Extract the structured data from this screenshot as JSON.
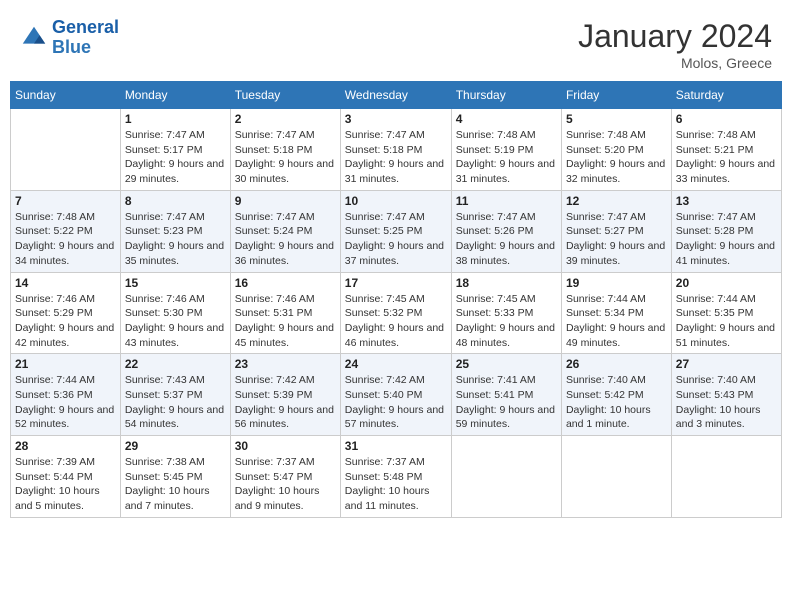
{
  "header": {
    "logo_line1": "General",
    "logo_line2": "Blue",
    "month_year": "January 2024",
    "location": "Molos, Greece"
  },
  "days_of_week": [
    "Sunday",
    "Monday",
    "Tuesday",
    "Wednesday",
    "Thursday",
    "Friday",
    "Saturday"
  ],
  "weeks": [
    [
      {
        "day": "",
        "sunrise": "",
        "sunset": "",
        "daylight": ""
      },
      {
        "day": "1",
        "sunrise": "Sunrise: 7:47 AM",
        "sunset": "Sunset: 5:17 PM",
        "daylight": "Daylight: 9 hours and 29 minutes."
      },
      {
        "day": "2",
        "sunrise": "Sunrise: 7:47 AM",
        "sunset": "Sunset: 5:18 PM",
        "daylight": "Daylight: 9 hours and 30 minutes."
      },
      {
        "day": "3",
        "sunrise": "Sunrise: 7:47 AM",
        "sunset": "Sunset: 5:18 PM",
        "daylight": "Daylight: 9 hours and 31 minutes."
      },
      {
        "day": "4",
        "sunrise": "Sunrise: 7:48 AM",
        "sunset": "Sunset: 5:19 PM",
        "daylight": "Daylight: 9 hours and 31 minutes."
      },
      {
        "day": "5",
        "sunrise": "Sunrise: 7:48 AM",
        "sunset": "Sunset: 5:20 PM",
        "daylight": "Daylight: 9 hours and 32 minutes."
      },
      {
        "day": "6",
        "sunrise": "Sunrise: 7:48 AM",
        "sunset": "Sunset: 5:21 PM",
        "daylight": "Daylight: 9 hours and 33 minutes."
      }
    ],
    [
      {
        "day": "7",
        "sunrise": "Sunrise: 7:48 AM",
        "sunset": "Sunset: 5:22 PM",
        "daylight": "Daylight: 9 hours and 34 minutes."
      },
      {
        "day": "8",
        "sunrise": "Sunrise: 7:47 AM",
        "sunset": "Sunset: 5:23 PM",
        "daylight": "Daylight: 9 hours and 35 minutes."
      },
      {
        "day": "9",
        "sunrise": "Sunrise: 7:47 AM",
        "sunset": "Sunset: 5:24 PM",
        "daylight": "Daylight: 9 hours and 36 minutes."
      },
      {
        "day": "10",
        "sunrise": "Sunrise: 7:47 AM",
        "sunset": "Sunset: 5:25 PM",
        "daylight": "Daylight: 9 hours and 37 minutes."
      },
      {
        "day": "11",
        "sunrise": "Sunrise: 7:47 AM",
        "sunset": "Sunset: 5:26 PM",
        "daylight": "Daylight: 9 hours and 38 minutes."
      },
      {
        "day": "12",
        "sunrise": "Sunrise: 7:47 AM",
        "sunset": "Sunset: 5:27 PM",
        "daylight": "Daylight: 9 hours and 39 minutes."
      },
      {
        "day": "13",
        "sunrise": "Sunrise: 7:47 AM",
        "sunset": "Sunset: 5:28 PM",
        "daylight": "Daylight: 9 hours and 41 minutes."
      }
    ],
    [
      {
        "day": "14",
        "sunrise": "Sunrise: 7:46 AM",
        "sunset": "Sunset: 5:29 PM",
        "daylight": "Daylight: 9 hours and 42 minutes."
      },
      {
        "day": "15",
        "sunrise": "Sunrise: 7:46 AM",
        "sunset": "Sunset: 5:30 PM",
        "daylight": "Daylight: 9 hours and 43 minutes."
      },
      {
        "day": "16",
        "sunrise": "Sunrise: 7:46 AM",
        "sunset": "Sunset: 5:31 PM",
        "daylight": "Daylight: 9 hours and 45 minutes."
      },
      {
        "day": "17",
        "sunrise": "Sunrise: 7:45 AM",
        "sunset": "Sunset: 5:32 PM",
        "daylight": "Daylight: 9 hours and 46 minutes."
      },
      {
        "day": "18",
        "sunrise": "Sunrise: 7:45 AM",
        "sunset": "Sunset: 5:33 PM",
        "daylight": "Daylight: 9 hours and 48 minutes."
      },
      {
        "day": "19",
        "sunrise": "Sunrise: 7:44 AM",
        "sunset": "Sunset: 5:34 PM",
        "daylight": "Daylight: 9 hours and 49 minutes."
      },
      {
        "day": "20",
        "sunrise": "Sunrise: 7:44 AM",
        "sunset": "Sunset: 5:35 PM",
        "daylight": "Daylight: 9 hours and 51 minutes."
      }
    ],
    [
      {
        "day": "21",
        "sunrise": "Sunrise: 7:44 AM",
        "sunset": "Sunset: 5:36 PM",
        "daylight": "Daylight: 9 hours and 52 minutes."
      },
      {
        "day": "22",
        "sunrise": "Sunrise: 7:43 AM",
        "sunset": "Sunset: 5:37 PM",
        "daylight": "Daylight: 9 hours and 54 minutes."
      },
      {
        "day": "23",
        "sunrise": "Sunrise: 7:42 AM",
        "sunset": "Sunset: 5:39 PM",
        "daylight": "Daylight: 9 hours and 56 minutes."
      },
      {
        "day": "24",
        "sunrise": "Sunrise: 7:42 AM",
        "sunset": "Sunset: 5:40 PM",
        "daylight": "Daylight: 9 hours and 57 minutes."
      },
      {
        "day": "25",
        "sunrise": "Sunrise: 7:41 AM",
        "sunset": "Sunset: 5:41 PM",
        "daylight": "Daylight: 9 hours and 59 minutes."
      },
      {
        "day": "26",
        "sunrise": "Sunrise: 7:40 AM",
        "sunset": "Sunset: 5:42 PM",
        "daylight": "Daylight: 10 hours and 1 minute."
      },
      {
        "day": "27",
        "sunrise": "Sunrise: 7:40 AM",
        "sunset": "Sunset: 5:43 PM",
        "daylight": "Daylight: 10 hours and 3 minutes."
      }
    ],
    [
      {
        "day": "28",
        "sunrise": "Sunrise: 7:39 AM",
        "sunset": "Sunset: 5:44 PM",
        "daylight": "Daylight: 10 hours and 5 minutes."
      },
      {
        "day": "29",
        "sunrise": "Sunrise: 7:38 AM",
        "sunset": "Sunset: 5:45 PM",
        "daylight": "Daylight: 10 hours and 7 minutes."
      },
      {
        "day": "30",
        "sunrise": "Sunrise: 7:37 AM",
        "sunset": "Sunset: 5:47 PM",
        "daylight": "Daylight: 10 hours and 9 minutes."
      },
      {
        "day": "31",
        "sunrise": "Sunrise: 7:37 AM",
        "sunset": "Sunset: 5:48 PM",
        "daylight": "Daylight: 10 hours and 11 minutes."
      },
      {
        "day": "",
        "sunrise": "",
        "sunset": "",
        "daylight": ""
      },
      {
        "day": "",
        "sunrise": "",
        "sunset": "",
        "daylight": ""
      },
      {
        "day": "",
        "sunrise": "",
        "sunset": "",
        "daylight": ""
      }
    ]
  ]
}
